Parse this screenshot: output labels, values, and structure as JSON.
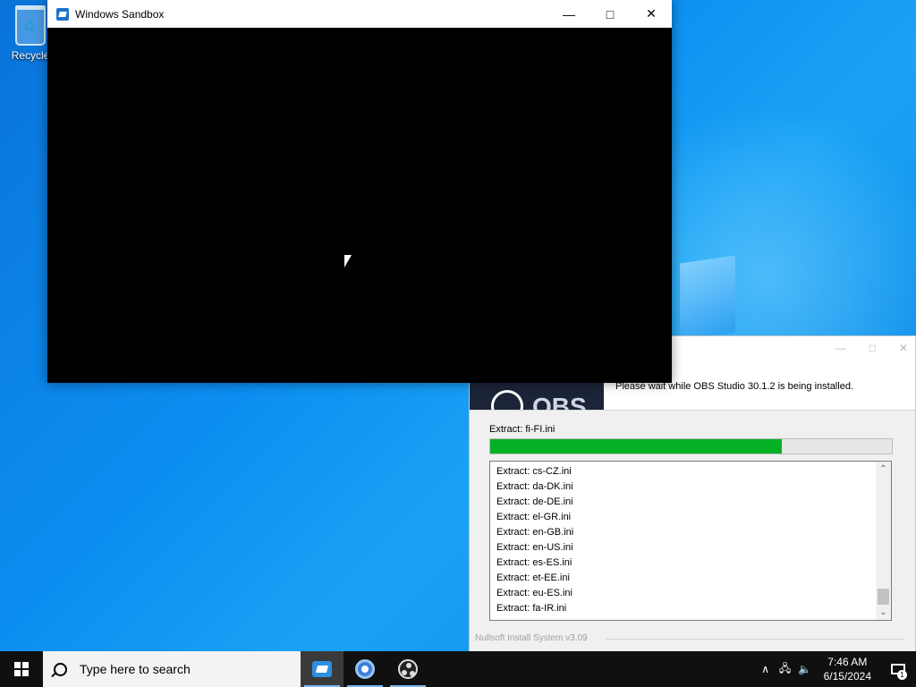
{
  "desktop": {
    "recycle_bin_label": "Recycle"
  },
  "sandbox_window": {
    "title": "Windows Sandbox",
    "minimize_glyph": "—",
    "maximize_glyph": "□",
    "close_glyph": "✕"
  },
  "installer": {
    "banner_text": "OBS",
    "status_text": "Please wait while OBS Studio 30.1.2 is being installed.",
    "extract_label": "Extract: fi-FI.ini",
    "progress_fraction": 0.725,
    "progress_color": "#06b025",
    "log_items": [
      "Extract: cs-CZ.ini",
      "Extract: da-DK.ini",
      "Extract: de-DE.ini",
      "Extract: el-GR.ini",
      "Extract: en-GB.ini",
      "Extract: en-US.ini",
      "Extract: es-ES.ini",
      "Extract: et-EE.ini",
      "Extract: eu-ES.ini",
      "Extract: fa-IR.ini"
    ],
    "branding": "Nullsoft Install System v3.09"
  },
  "taskbar": {
    "search_placeholder": "Type here to search",
    "apps": [
      {
        "name": "windows-sandbox-icon",
        "active": true
      },
      {
        "name": "chrome-icon",
        "active": false
      },
      {
        "name": "obs-icon",
        "active": false
      }
    ],
    "tray": {
      "chevron_glyph": "∧",
      "time": "7:46 AM",
      "date": "6/15/2024",
      "notification_count": "1"
    }
  }
}
